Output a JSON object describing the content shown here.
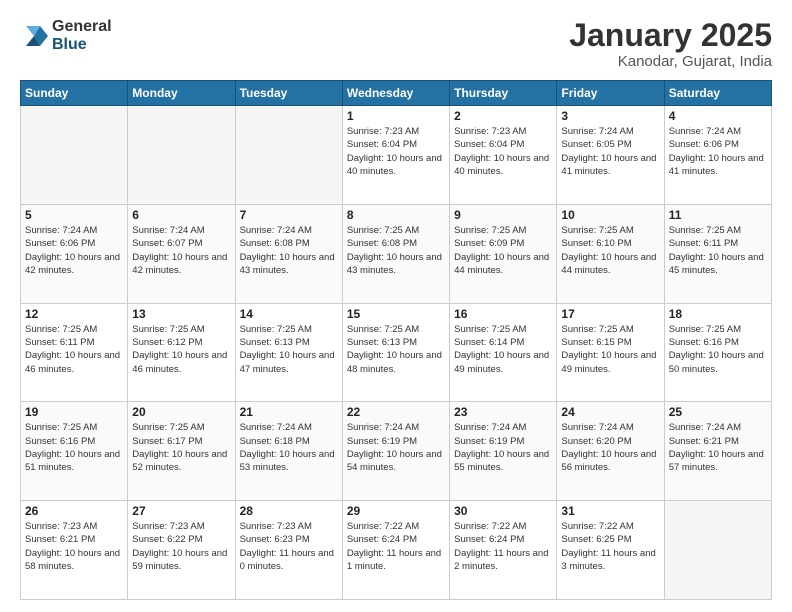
{
  "header": {
    "logo_general": "General",
    "logo_blue": "Blue",
    "title": "January 2025",
    "location": "Kanodar, Gujarat, India"
  },
  "weekdays": [
    "Sunday",
    "Monday",
    "Tuesday",
    "Wednesday",
    "Thursday",
    "Friday",
    "Saturday"
  ],
  "weeks": [
    [
      {
        "day": "",
        "info": ""
      },
      {
        "day": "",
        "info": ""
      },
      {
        "day": "",
        "info": ""
      },
      {
        "day": "1",
        "info": "Sunrise: 7:23 AM\nSunset: 6:04 PM\nDaylight: 10 hours\nand 40 minutes."
      },
      {
        "day": "2",
        "info": "Sunrise: 7:23 AM\nSunset: 6:04 PM\nDaylight: 10 hours\nand 40 minutes."
      },
      {
        "day": "3",
        "info": "Sunrise: 7:24 AM\nSunset: 6:05 PM\nDaylight: 10 hours\nand 41 minutes."
      },
      {
        "day": "4",
        "info": "Sunrise: 7:24 AM\nSunset: 6:06 PM\nDaylight: 10 hours\nand 41 minutes."
      }
    ],
    [
      {
        "day": "5",
        "info": "Sunrise: 7:24 AM\nSunset: 6:06 PM\nDaylight: 10 hours\nand 42 minutes."
      },
      {
        "day": "6",
        "info": "Sunrise: 7:24 AM\nSunset: 6:07 PM\nDaylight: 10 hours\nand 42 minutes."
      },
      {
        "day": "7",
        "info": "Sunrise: 7:24 AM\nSunset: 6:08 PM\nDaylight: 10 hours\nand 43 minutes."
      },
      {
        "day": "8",
        "info": "Sunrise: 7:25 AM\nSunset: 6:08 PM\nDaylight: 10 hours\nand 43 minutes."
      },
      {
        "day": "9",
        "info": "Sunrise: 7:25 AM\nSunset: 6:09 PM\nDaylight: 10 hours\nand 44 minutes."
      },
      {
        "day": "10",
        "info": "Sunrise: 7:25 AM\nSunset: 6:10 PM\nDaylight: 10 hours\nand 44 minutes."
      },
      {
        "day": "11",
        "info": "Sunrise: 7:25 AM\nSunset: 6:11 PM\nDaylight: 10 hours\nand 45 minutes."
      }
    ],
    [
      {
        "day": "12",
        "info": "Sunrise: 7:25 AM\nSunset: 6:11 PM\nDaylight: 10 hours\nand 46 minutes."
      },
      {
        "day": "13",
        "info": "Sunrise: 7:25 AM\nSunset: 6:12 PM\nDaylight: 10 hours\nand 46 minutes."
      },
      {
        "day": "14",
        "info": "Sunrise: 7:25 AM\nSunset: 6:13 PM\nDaylight: 10 hours\nand 47 minutes."
      },
      {
        "day": "15",
        "info": "Sunrise: 7:25 AM\nSunset: 6:13 PM\nDaylight: 10 hours\nand 48 minutes."
      },
      {
        "day": "16",
        "info": "Sunrise: 7:25 AM\nSunset: 6:14 PM\nDaylight: 10 hours\nand 49 minutes."
      },
      {
        "day": "17",
        "info": "Sunrise: 7:25 AM\nSunset: 6:15 PM\nDaylight: 10 hours\nand 49 minutes."
      },
      {
        "day": "18",
        "info": "Sunrise: 7:25 AM\nSunset: 6:16 PM\nDaylight: 10 hours\nand 50 minutes."
      }
    ],
    [
      {
        "day": "19",
        "info": "Sunrise: 7:25 AM\nSunset: 6:16 PM\nDaylight: 10 hours\nand 51 minutes."
      },
      {
        "day": "20",
        "info": "Sunrise: 7:25 AM\nSunset: 6:17 PM\nDaylight: 10 hours\nand 52 minutes."
      },
      {
        "day": "21",
        "info": "Sunrise: 7:24 AM\nSunset: 6:18 PM\nDaylight: 10 hours\nand 53 minutes."
      },
      {
        "day": "22",
        "info": "Sunrise: 7:24 AM\nSunset: 6:19 PM\nDaylight: 10 hours\nand 54 minutes."
      },
      {
        "day": "23",
        "info": "Sunrise: 7:24 AM\nSunset: 6:19 PM\nDaylight: 10 hours\nand 55 minutes."
      },
      {
        "day": "24",
        "info": "Sunrise: 7:24 AM\nSunset: 6:20 PM\nDaylight: 10 hours\nand 56 minutes."
      },
      {
        "day": "25",
        "info": "Sunrise: 7:24 AM\nSunset: 6:21 PM\nDaylight: 10 hours\nand 57 minutes."
      }
    ],
    [
      {
        "day": "26",
        "info": "Sunrise: 7:23 AM\nSunset: 6:21 PM\nDaylight: 10 hours\nand 58 minutes."
      },
      {
        "day": "27",
        "info": "Sunrise: 7:23 AM\nSunset: 6:22 PM\nDaylight: 10 hours\nand 59 minutes."
      },
      {
        "day": "28",
        "info": "Sunrise: 7:23 AM\nSunset: 6:23 PM\nDaylight: 11 hours\nand 0 minutes."
      },
      {
        "day": "29",
        "info": "Sunrise: 7:22 AM\nSunset: 6:24 PM\nDaylight: 11 hours\nand 1 minute."
      },
      {
        "day": "30",
        "info": "Sunrise: 7:22 AM\nSunset: 6:24 PM\nDaylight: 11 hours\nand 2 minutes."
      },
      {
        "day": "31",
        "info": "Sunrise: 7:22 AM\nSunset: 6:25 PM\nDaylight: 11 hours\nand 3 minutes."
      },
      {
        "day": "",
        "info": ""
      }
    ]
  ]
}
